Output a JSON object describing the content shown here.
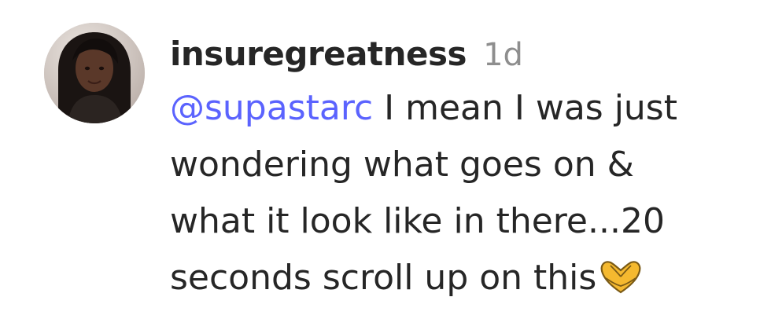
{
  "comment": {
    "username": "insuregreatness",
    "timestamp": "1d",
    "mention": "@supastarc",
    "lines": [
      " I mean I was just",
      "wondering what goes on &",
      "what it look like in there...20",
      "seconds scroll up on this"
    ],
    "reaction_icon": "heart-hands-emoji"
  },
  "colors": {
    "mention": "#5b63fe",
    "username": "#262626",
    "timestamp": "#8e8e8e",
    "emoji": "#f5b92f"
  }
}
